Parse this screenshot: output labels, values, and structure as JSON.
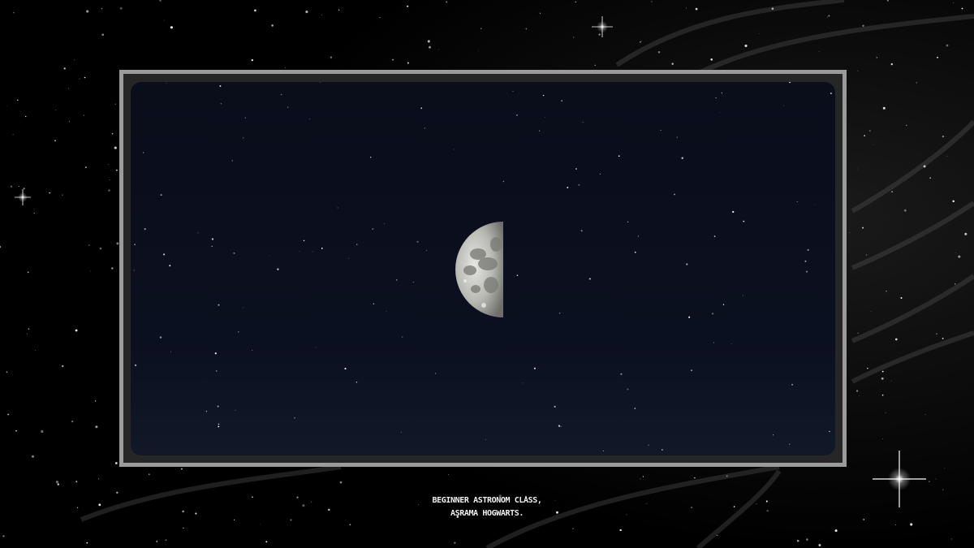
{
  "caption": {
    "line1": "BEGINNER ASTRONOM CLASS,",
    "line2": "ASRAMA HOGWARTS."
  },
  "colors": {
    "background": "#000000",
    "frame_border": "#9b9b9b",
    "frame_fill": "#262626",
    "sky": "#0a0f1c",
    "caption_text": "#f0f0f0"
  },
  "scene": {
    "background": "starfield with grey nebula streaks",
    "photo_subject": "half moon in night sky",
    "moon_phase": "first quarter (left half lit)"
  }
}
